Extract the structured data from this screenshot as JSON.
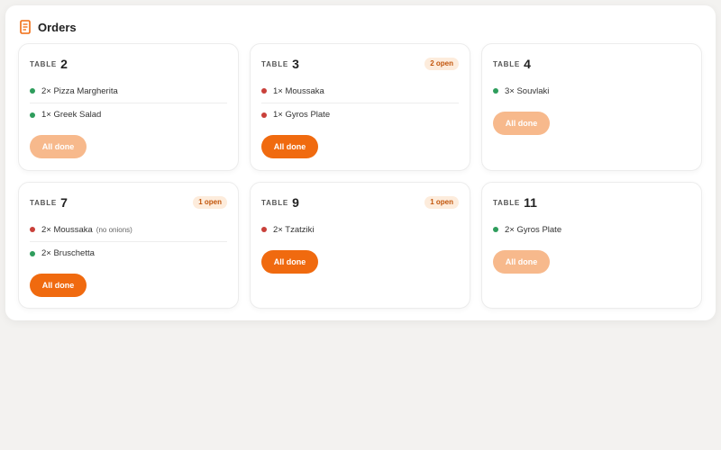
{
  "header": {
    "title": "Orders",
    "icon": "receipt-icon"
  },
  "colors": {
    "accent": "#f06a0f",
    "accent_muted": "#f7b98c",
    "done": "#2e9d5c",
    "open": "#c9403a",
    "badge_bg": "#fdecdc"
  },
  "cards": [
    {
      "table_label": "TABLE",
      "table_number": "2",
      "open_badge": "",
      "items": [
        {
          "status": "done",
          "text": "2× Pizza Margherita",
          "note": ""
        },
        {
          "status": "done",
          "text": "1× Greek Salad",
          "note": ""
        }
      ],
      "button_label": "All done",
      "button_enabled": false
    },
    {
      "table_label": "TABLE",
      "table_number": "3",
      "open_badge": "2 open",
      "items": [
        {
          "status": "open",
          "text": "1× Moussaka",
          "note": ""
        },
        {
          "status": "open",
          "text": "1× Gyros Plate",
          "note": ""
        }
      ],
      "button_label": "All done",
      "button_enabled": true
    },
    {
      "table_label": "TABLE",
      "table_number": "4",
      "open_badge": "",
      "items": [
        {
          "status": "done",
          "text": "3× Souvlaki",
          "note": ""
        }
      ],
      "button_label": "All done",
      "button_enabled": false
    },
    {
      "table_label": "TABLE",
      "table_number": "7",
      "open_badge": "1 open",
      "items": [
        {
          "status": "open",
          "text": "2× Moussaka",
          "note": "(no onions)"
        },
        {
          "status": "done",
          "text": "2× Bruschetta",
          "note": ""
        }
      ],
      "button_label": "All done",
      "button_enabled": true
    },
    {
      "table_label": "TABLE",
      "table_number": "9",
      "open_badge": "1 open",
      "items": [
        {
          "status": "open",
          "text": "2× Tzatziki",
          "note": ""
        }
      ],
      "button_label": "All done",
      "button_enabled": true
    },
    {
      "table_label": "TABLE",
      "table_number": "11",
      "open_badge": "",
      "items": [
        {
          "status": "done",
          "text": "2× Gyros Plate",
          "note": ""
        }
      ],
      "button_label": "All done",
      "button_enabled": false
    }
  ]
}
